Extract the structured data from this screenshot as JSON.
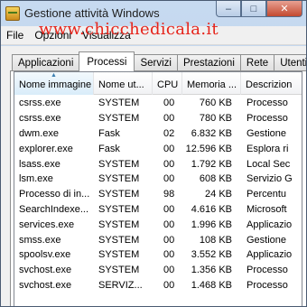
{
  "window": {
    "title": "Gestione attività Windows",
    "controls": {
      "minimize": "–",
      "maximize": "□",
      "close": "✕"
    }
  },
  "menu": {
    "file": "File",
    "options": "Opzioni",
    "view": "Visualizza"
  },
  "watermark": "www.chicchedicala.it",
  "tabs": [
    "Applicazioni",
    "Processi",
    "Servizi",
    "Prestazioni",
    "Rete",
    "Utenti"
  ],
  "active_tab": "Processi",
  "columns": {
    "name": "Nome immagine",
    "user": "Nome ut...",
    "cpu": "CPU",
    "memory": "Memoria ...",
    "description": "Descrizion"
  },
  "processes": [
    {
      "name": "csrss.exe",
      "user": "SYSTEM",
      "cpu": "00",
      "memory": "760 KB",
      "description": "Processo"
    },
    {
      "name": "csrss.exe",
      "user": "SYSTEM",
      "cpu": "00",
      "memory": "780 KB",
      "description": "Processo"
    },
    {
      "name": "dwm.exe",
      "user": "Fask",
      "cpu": "02",
      "memory": "6.832 KB",
      "description": "Gestione"
    },
    {
      "name": "explorer.exe",
      "user": "Fask",
      "cpu": "00",
      "memory": "12.596 KB",
      "description": "Esplora ri"
    },
    {
      "name": "lsass.exe",
      "user": "SYSTEM",
      "cpu": "00",
      "memory": "1.792 KB",
      "description": "Local Sec"
    },
    {
      "name": "lsm.exe",
      "user": "SYSTEM",
      "cpu": "00",
      "memory": "608 KB",
      "description": "Servizio G"
    },
    {
      "name": "Processo di in...",
      "user": "SYSTEM",
      "cpu": "98",
      "memory": "24 KB",
      "description": "Percentu"
    },
    {
      "name": "SearchIndexe...",
      "user": "SYSTEM",
      "cpu": "00",
      "memory": "4.616 KB",
      "description": "Microsoft"
    },
    {
      "name": "services.exe",
      "user": "SYSTEM",
      "cpu": "00",
      "memory": "1.996 KB",
      "description": "Applicazio"
    },
    {
      "name": "smss.exe",
      "user": "SYSTEM",
      "cpu": "00",
      "memory": "108 KB",
      "description": "Gestione"
    },
    {
      "name": "spoolsv.exe",
      "user": "SYSTEM",
      "cpu": "00",
      "memory": "3.552 KB",
      "description": "Applicazio"
    },
    {
      "name": "svchost.exe",
      "user": "SYSTEM",
      "cpu": "00",
      "memory": "1.356 KB",
      "description": "Processo"
    },
    {
      "name": "svchost.exe",
      "user": "SERVIZ...",
      "cpu": "00",
      "memory": "1.468 KB",
      "description": "Processo"
    }
  ],
  "icons": {
    "app": "task-manager-icon",
    "sort": "sort-ascending-icon"
  },
  "colors": {
    "watermark": "#e6241b",
    "titlebar": "#b9d1ea",
    "sorted_header": "#d9ecf9"
  }
}
